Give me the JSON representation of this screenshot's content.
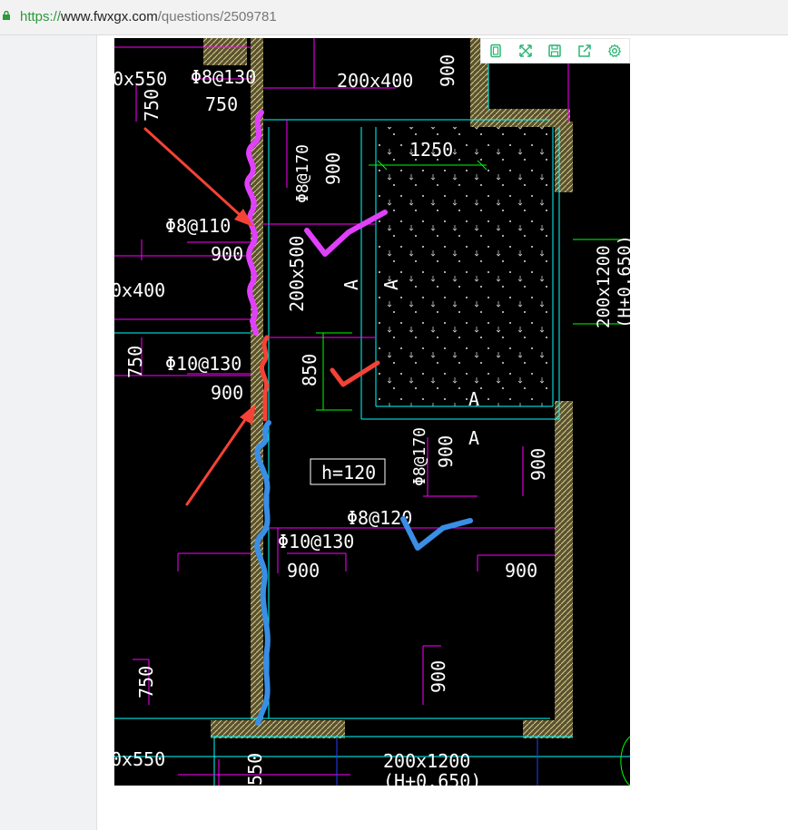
{
  "browser": {
    "url_scheme": "https://",
    "url_host": "www.fwxgx.com",
    "url_path": "/questions/2509781"
  },
  "toolbar": {
    "buttons": [
      "fit-page-icon",
      "fullscreen-icon",
      "save-icon",
      "share-icon",
      "settings-icon"
    ],
    "icon_color": "#2bb673"
  },
  "drawing": {
    "colors": {
      "background": "#000000",
      "magenta": "#ff00ff",
      "cyan": "#00ffff",
      "green": "#00ff00",
      "white": "#ffffff",
      "hatch": "#c8c080",
      "mark_magenta": "#e040fb",
      "mark_red": "#f44336",
      "mark_blue": "#3a8ee6"
    },
    "labels": {
      "beam_200x550_top": "0x550",
      "rebar_8_130": "Φ8@130",
      "dim_750_a": "750",
      "dim_750_b": "750",
      "beam_200x400_top": "200x400",
      "dim_900_top": "900",
      "dim_1250": "1250",
      "rebar_8_170_a": "Φ8@170",
      "dim_900_a": "900",
      "rebar_8_110": "Φ8@110",
      "dim_900_b": "900",
      "beam_200x500": "200x500",
      "sec_A_1": "A",
      "sec_A_2": "A",
      "beam_200x400_left": "0x400",
      "beam_200x1200_right": "200x1200",
      "beam_elev_right": "(H+0.650)",
      "dim_750_c": "750",
      "rebar_10_130_a": "Φ10@130",
      "dim_850": "850",
      "dim_900_c": "900",
      "sec_A_3": "A",
      "sec_A_4": "A",
      "rebar_8_170_b": "Φ8@170",
      "dim_900_d": "900",
      "dim_900_e": "900",
      "slab_h": "h=120",
      "rebar_8_120": "Φ8@120",
      "rebar_10_130_b": "Φ10@130",
      "dim_900_f": "900",
      "dim_900_g": "900",
      "dim_750_d": "750",
      "dim_900_h": "900",
      "beam_200x550_bottom": "0x550",
      "beam_200x1200_bottom": "200x1200",
      "beam_elev_bottom": "(H+0.650)",
      "dim_550": "550"
    }
  }
}
